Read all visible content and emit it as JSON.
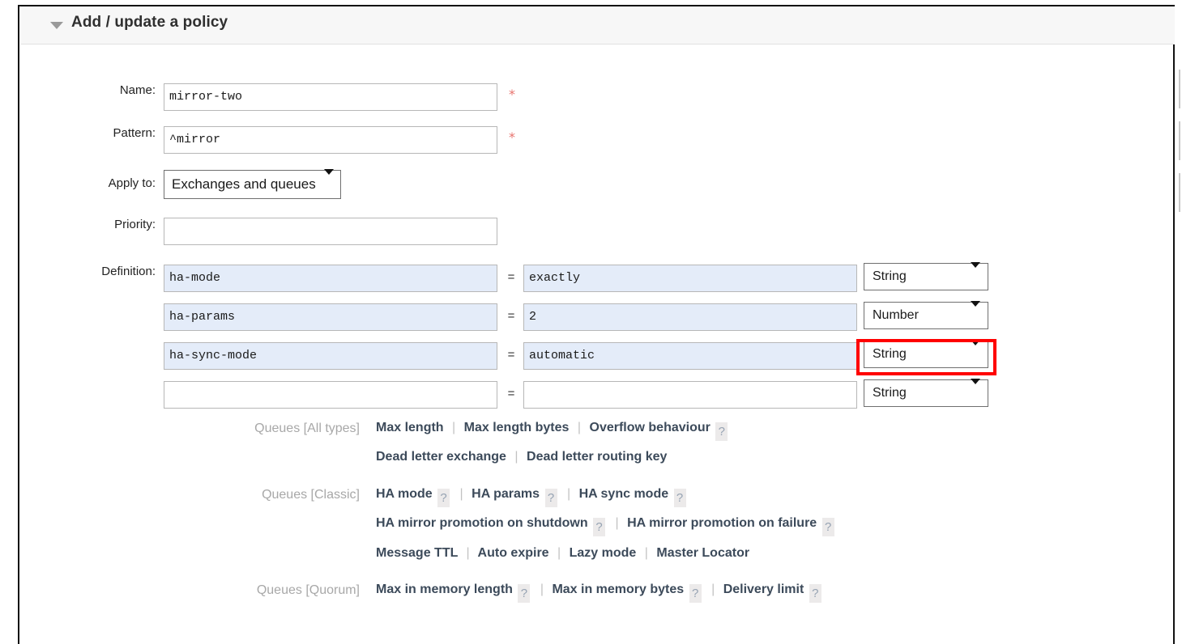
{
  "panel": {
    "title": "Add / update a policy",
    "collapse_icon": "triangle-down-icon"
  },
  "form": {
    "fields": [
      {
        "label": "Name:",
        "value": "mirror-two",
        "required": true
      },
      {
        "label": "Pattern:",
        "value": "^mirror",
        "required": true
      },
      {
        "label": "Apply to:",
        "value": "Exchanges and queues",
        "required": false
      },
      {
        "label": "Priority:",
        "value": "",
        "required": false
      },
      {
        "label": "Definition:",
        "value": "",
        "required": false
      }
    ],
    "required_marker": "*",
    "apply_to_selected": "Exchanges and queues",
    "priority_value": "",
    "equals_sign": "="
  },
  "definitions": {
    "rows": [
      {
        "key": "ha-mode",
        "value": "exactly",
        "type": "String",
        "highlighted": false
      },
      {
        "key": "ha-params",
        "value": "2",
        "type": "Number",
        "highlighted": true
      },
      {
        "key": "ha-sync-mode",
        "value": "automatic",
        "type": "String",
        "highlighted": false
      },
      {
        "key": "",
        "value": "",
        "type": "String",
        "highlighted": false
      }
    ],
    "highlight_color": "#ff0000",
    "filled_bg": "#e4ecf9"
  },
  "shortcuts": {
    "help_glyph": "?",
    "separator": "|",
    "groups": [
      {
        "label": "Queues [All types]",
        "lines": [
          [
            {
              "text": "Max length",
              "help": false
            },
            {
              "text": "Max length bytes",
              "help": false
            },
            {
              "text": "Overflow behaviour",
              "help": true
            }
          ],
          [
            {
              "text": "Dead letter exchange",
              "help": false
            },
            {
              "text": "Dead letter routing key",
              "help": false
            }
          ]
        ]
      },
      {
        "label": "Queues [Classic]",
        "lines": [
          [
            {
              "text": "HA mode",
              "help": true
            },
            {
              "text": "HA params",
              "help": true
            },
            {
              "text": "HA sync mode",
              "help": true
            }
          ],
          [
            {
              "text": "HA mirror promotion on shutdown",
              "help": true
            },
            {
              "text": "HA mirror promotion on failure",
              "help": true
            }
          ],
          [
            {
              "text": "Message TTL",
              "help": false
            },
            {
              "text": "Auto expire",
              "help": false
            },
            {
              "text": "Lazy mode",
              "help": false
            },
            {
              "text": "Master Locator",
              "help": false
            }
          ]
        ]
      },
      {
        "label": "Queues [Quorum]",
        "lines": [
          [
            {
              "text": "Max in memory length",
              "help": true
            },
            {
              "text": "Max in memory bytes",
              "help": true
            },
            {
              "text": "Delivery limit",
              "help": true
            }
          ]
        ]
      }
    ]
  }
}
